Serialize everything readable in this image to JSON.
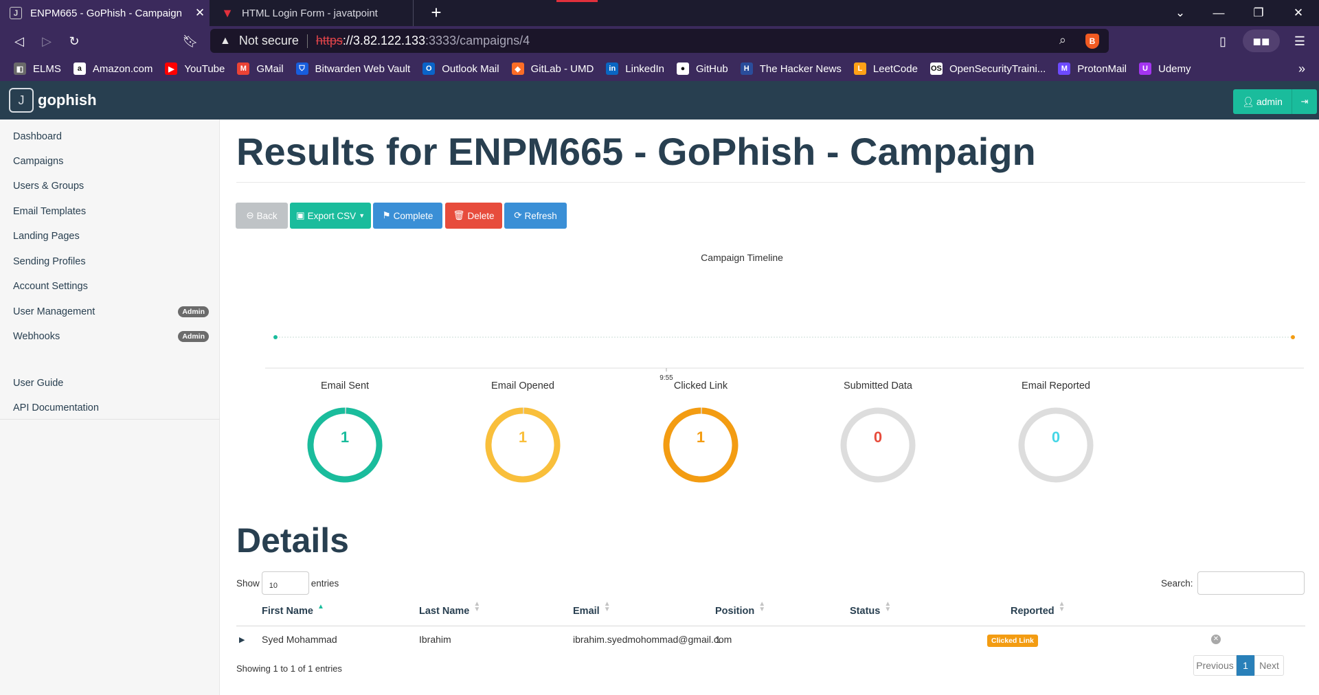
{
  "browser": {
    "tabs": [
      {
        "title": "ENPM665 - GoPhish - Campaign",
        "active": true
      },
      {
        "title": "HTML Login Form - javatpoint",
        "active": false
      }
    ],
    "url": {
      "security": "Not secure",
      "scheme": "https",
      "host": "://3.82.122.133",
      "path": ":3333/campaigns/4"
    },
    "bookmarks": [
      {
        "label": "ELMS",
        "icon": "elms-icon",
        "color": "#6a6a6a"
      },
      {
        "label": "Amazon.com",
        "icon": "amazon-icon",
        "color": "#ffffff"
      },
      {
        "label": "YouTube",
        "icon": "youtube-icon",
        "color": "#ff0000"
      },
      {
        "label": "GMail",
        "icon": "gmail-icon",
        "color": "#ea4335"
      },
      {
        "label": "Bitwarden Web Vault",
        "icon": "bitwarden-icon",
        "color": "#175ddc"
      },
      {
        "label": "Outlook Mail",
        "icon": "outlook-icon",
        "color": "#0a64c8"
      },
      {
        "label": "GitLab - UMD",
        "icon": "gitlab-icon",
        "color": "#fc6d26"
      },
      {
        "label": "LinkedIn",
        "icon": "linkedin-icon",
        "color": "#0a66c2"
      },
      {
        "label": "GitHub",
        "icon": "github-icon",
        "color": "#ffffff"
      },
      {
        "label": "The Hacker News",
        "icon": "hackernews-icon",
        "color": "#2a4d9b"
      },
      {
        "label": "LeetCode",
        "icon": "leetcode-icon",
        "color": "#ffa116"
      },
      {
        "label": "OpenSecurityTraini...",
        "icon": "ost2-icon",
        "color": "#ffffff"
      },
      {
        "label": "ProtonMail",
        "icon": "protonmail-icon",
        "color": "#6d4aff"
      },
      {
        "label": "Udemy",
        "icon": "udemy-icon",
        "color": "#a435f0"
      }
    ]
  },
  "app": {
    "brand": "gophish",
    "user": "admin",
    "sidebar": {
      "items": [
        {
          "label": "Dashboard"
        },
        {
          "label": "Campaigns"
        },
        {
          "label": "Users & Groups"
        },
        {
          "label": "Email Templates"
        },
        {
          "label": "Landing Pages"
        },
        {
          "label": "Sending Profiles"
        },
        {
          "label": "Account Settings"
        },
        {
          "label": "User Management",
          "badge": "Admin"
        },
        {
          "label": "Webhooks",
          "badge": "Admin"
        }
      ],
      "secondary": [
        {
          "label": "User Guide"
        },
        {
          "label": "API Documentation"
        }
      ]
    },
    "page_title": "Results for ENPM665 - GoPhish - Campaign",
    "buttons": {
      "back": "Back",
      "export": "Export CSV",
      "complete": "Complete",
      "delete": "Delete",
      "refresh": "Refresh"
    },
    "timeline": {
      "title": "Campaign Timeline",
      "tick": "9:55"
    },
    "stats": [
      {
        "label": "Email Sent",
        "value": "1",
        "fraction": 1,
        "color": "#1abc9c"
      },
      {
        "label": "Email Opened",
        "value": "1",
        "fraction": 1,
        "color": "#f9bf3b"
      },
      {
        "label": "Clicked Link",
        "value": "1",
        "fraction": 1,
        "color": "#f39c12"
      },
      {
        "label": "Submitted Data",
        "value": "0",
        "fraction": 0,
        "color": "#e74c3c"
      },
      {
        "label": "Email Reported",
        "value": "0",
        "fraction": 0,
        "color": "#45d6e6"
      }
    ],
    "details": {
      "title": "Details",
      "show_label": "Show",
      "entries_value": "10",
      "entries_label": "entries",
      "search_label": "Search:",
      "columns": [
        "First Name",
        "Last Name",
        "Email",
        "Position",
        "Status",
        "Reported"
      ],
      "rows": [
        {
          "first": "Syed Mohammad",
          "last": "Ibrahim",
          "email": "ibrahim.syedmohommad@gmail.com",
          "position": "1",
          "status": "Clicked Link"
        }
      ],
      "info": "Showing 1 to 1 of 1 entries",
      "pagination": {
        "previous": "Previous",
        "current": "1",
        "next": "Next"
      }
    }
  }
}
